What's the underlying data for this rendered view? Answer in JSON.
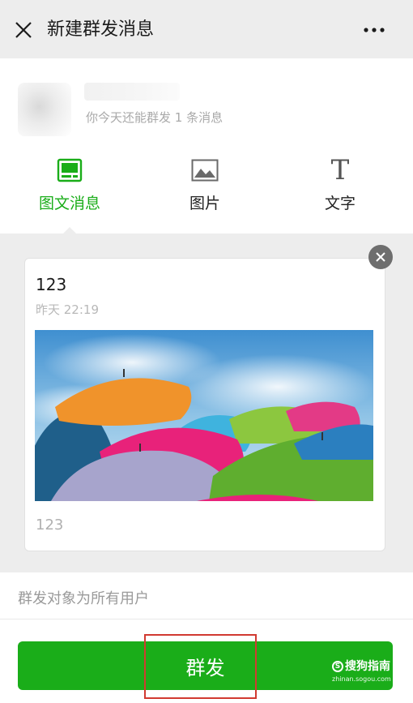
{
  "header": {
    "title": "新建群发消息",
    "close_icon": "close-icon",
    "more_icon": "more-icon"
  },
  "account": {
    "quota_text": "你今天还能群发 1 条消息"
  },
  "tabs": [
    {
      "label": "图文消息",
      "icon": "article-icon",
      "active": true
    },
    {
      "label": "图片",
      "icon": "image-icon",
      "active": false
    },
    {
      "label": "文字",
      "icon": "text-icon",
      "glyph": "T",
      "active": false
    }
  ],
  "card": {
    "title": "123",
    "time": "昨天 22:19",
    "digest": "123",
    "image_icon": "umbrella-photo"
  },
  "audience": {
    "text": "群发对象为所有用户"
  },
  "send": {
    "label": "群发"
  },
  "watermark": {
    "text": "搜狗指南",
    "domain": "zhinan.sogou.com"
  },
  "colors": {
    "accent": "#1aad19",
    "highlight": "#d13a31",
    "background": "#ededed"
  }
}
